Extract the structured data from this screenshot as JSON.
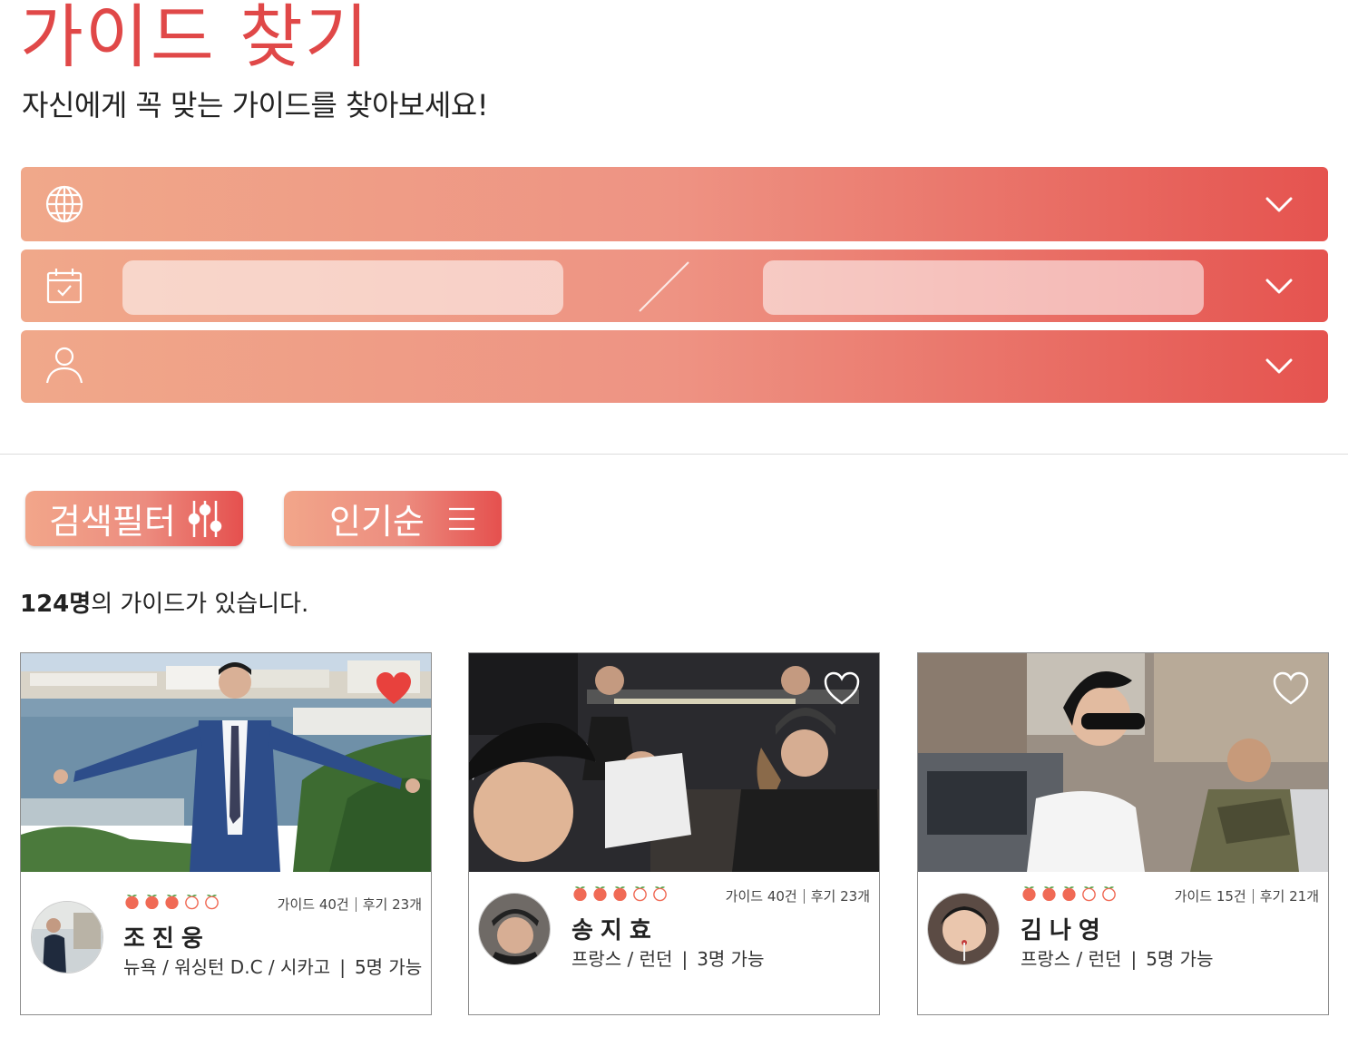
{
  "header": {
    "title": "가이드 찾기",
    "subtitle": "자신에게 꼭 맞는 가이드를 찾아보세요!"
  },
  "search": {
    "destination_icon": "globe-icon",
    "date_icon": "calendar-check-icon",
    "people_icon": "person-icon",
    "dropdown_icon": "chevron-down-icon",
    "start_date_value": "",
    "end_date_value": "",
    "date_separator_icon": "slash-divider"
  },
  "controls": {
    "filter_label": "검색필터",
    "filter_icon": "sliders-icon",
    "sort_label": "인기순",
    "sort_icon": "menu-lines-icon"
  },
  "results": {
    "count": "124명",
    "count_suffix": "의 가이드가 있습니다."
  },
  "guides": [
    {
      "name": "조진웅",
      "favorited": true,
      "rating": 3,
      "rating_max": 5,
      "guide_count": "가이드 40건",
      "review_count": "후기 23개",
      "location": "뉴욕 / 워싱턴 D.C / 시카고",
      "capacity": "5명 가능"
    },
    {
      "name": "송지효",
      "favorited": false,
      "rating": 3,
      "rating_max": 5,
      "guide_count": "가이드 40건",
      "review_count": "후기 23개",
      "location": "프랑스 / 런던",
      "capacity": "3명 가능"
    },
    {
      "name": "김나영",
      "favorited": false,
      "rating": 3,
      "rating_max": 5,
      "guide_count": "가이드 15건",
      "review_count": "후기 21개",
      "location": "프랑스 / 런던",
      "capacity": "5명 가능"
    }
  ],
  "colors": {
    "brand_red": "#e04848",
    "gradient_start": "#f0a88a",
    "gradient_end": "#e5534f",
    "peach_filled": "#f06a55"
  }
}
